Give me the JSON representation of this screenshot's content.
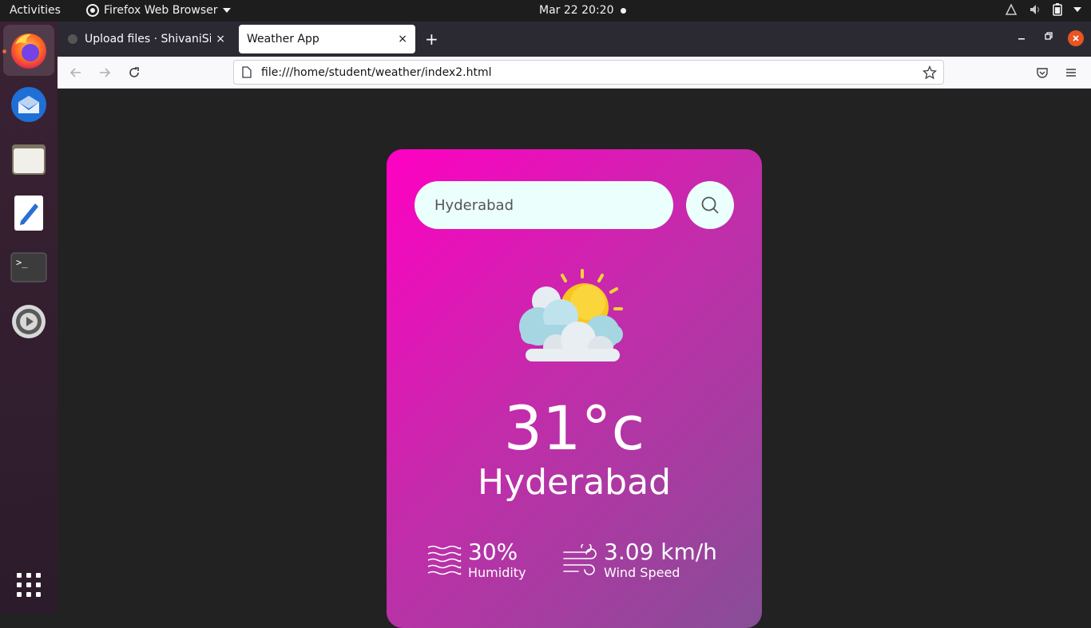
{
  "topbar": {
    "activities": "Activities",
    "app_name": "Firefox Web Browser",
    "clock": "Mar 22  20:20"
  },
  "dock": {
    "items": [
      "firefox-icon",
      "thunderbird-icon",
      "files-icon",
      "text-editor-icon",
      "terminal-icon",
      "settings-icon",
      "app-grid-icon"
    ]
  },
  "browser": {
    "tabs": [
      {
        "label": "Upload files · ShivaniSirip",
        "close": "×"
      },
      {
        "label": "Weather App",
        "close": "×"
      }
    ],
    "new_tab": "+",
    "url": "file:///home/student/weather/index2.html"
  },
  "weather": {
    "search_value": "Hyderabad",
    "temperature": "31°c",
    "city": "Hyderabad",
    "humidity_value": "30%",
    "humidity_label": "Humidity",
    "wind_value": "3.09 km/h",
    "wind_label": "Wind Speed"
  },
  "colors": {
    "card_gradient_start": "#ff00c3",
    "card_gradient_end": "#874e96",
    "input_bg": "#ebfffc",
    "accent_close": "#e95420"
  }
}
